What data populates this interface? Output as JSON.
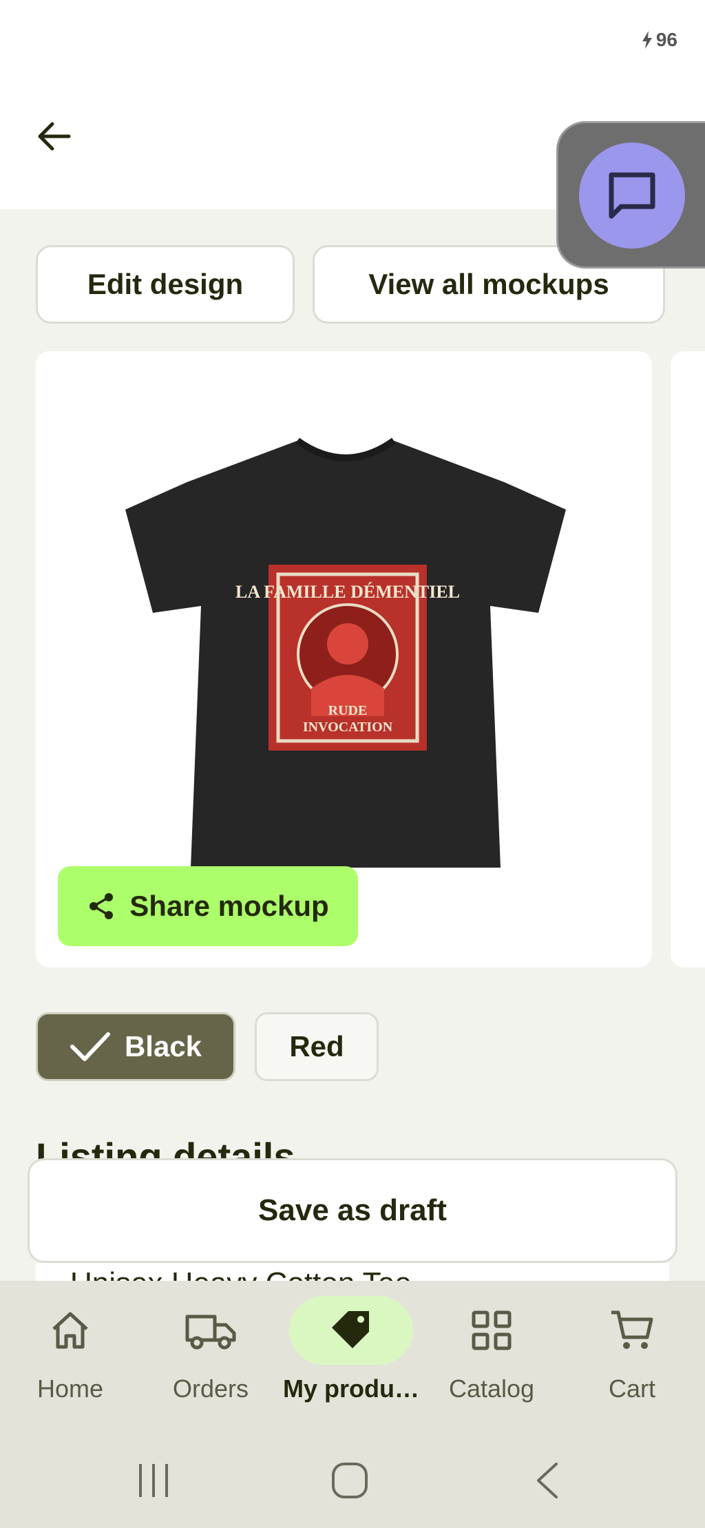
{
  "status_bar": {
    "battery": "96"
  },
  "header": {
    "back_icon": "arrow-left-icon",
    "chat_icon": "chat-bubble-icon"
  },
  "actions": {
    "edit_design": "Edit design",
    "view_all_mockups": "View all mockups"
  },
  "mockup": {
    "share_label": "Share mockup",
    "share_icon": "share-icon",
    "print_lines": [
      "LA FAMILLE DÉMENTIEL",
      "RUDE",
      "INVOCATION"
    ]
  },
  "colors": {
    "options": [
      "Black",
      "Red"
    ],
    "selected": "Black"
  },
  "listing": {
    "heading": "Listing details",
    "title_peek": "Unisex Heavy Cotton Tee"
  },
  "footer": {
    "save_draft": "Save as draft"
  },
  "bottom_nav": {
    "items": [
      {
        "label": "Home",
        "icon": "home-icon"
      },
      {
        "label": "Orders",
        "icon": "truck-icon"
      },
      {
        "label": "My produ…",
        "icon": "tag-icon",
        "active": true
      },
      {
        "label": "Catalog",
        "icon": "grid-icon"
      },
      {
        "label": "Cart",
        "icon": "cart-icon"
      }
    ]
  },
  "theme": {
    "accent_green": "#acff6a",
    "selected_chip": "#66654a",
    "chat_purple": "#9b97ec"
  }
}
